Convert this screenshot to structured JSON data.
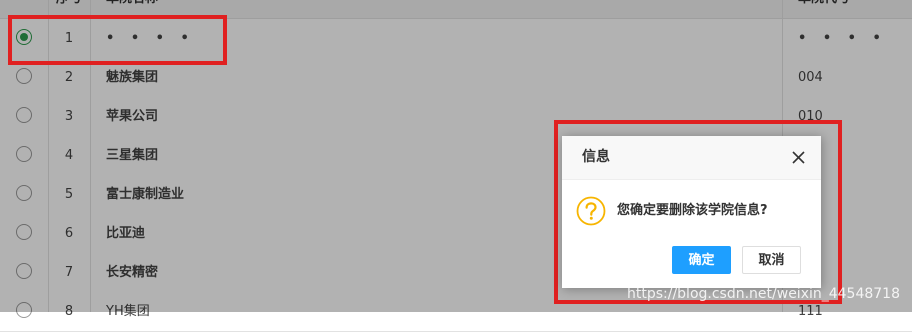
{
  "table": {
    "header": {
      "number": "序号",
      "name": "单院名称",
      "code": "单院代号"
    },
    "rows": [
      {
        "number": "1",
        "name": "• • • •",
        "code": "• • • •",
        "selected": true
      },
      {
        "number": "2",
        "name": "魅族集团",
        "code": "004",
        "selected": false
      },
      {
        "number": "3",
        "name": "苹果公司",
        "code": "010",
        "selected": false
      },
      {
        "number": "4",
        "name": "三星集团",
        "code": "",
        "selected": false
      },
      {
        "number": "5",
        "name": "富士康制造业",
        "code": "",
        "selected": false
      },
      {
        "number": "6",
        "name": "比亚迪",
        "code": "",
        "selected": false
      },
      {
        "number": "7",
        "name": "长安精密",
        "code": "",
        "selected": false
      },
      {
        "number": "8",
        "name": "YH集团",
        "code": "111",
        "selected": false
      }
    ]
  },
  "dialog": {
    "title": "信息",
    "message": "您确定要删除该学院信息?",
    "ok_label": "确定",
    "cancel_label": "取消",
    "icon": "question-icon",
    "close_icon": "close-icon"
  },
  "watermark": "https://blog.csdn.net/weixin_44548718",
  "colors": {
    "highlight": "#e02020",
    "primary_button": "#1e9fff",
    "question_icon": "#f7b500",
    "radio_checked": "#2e9b4e"
  }
}
